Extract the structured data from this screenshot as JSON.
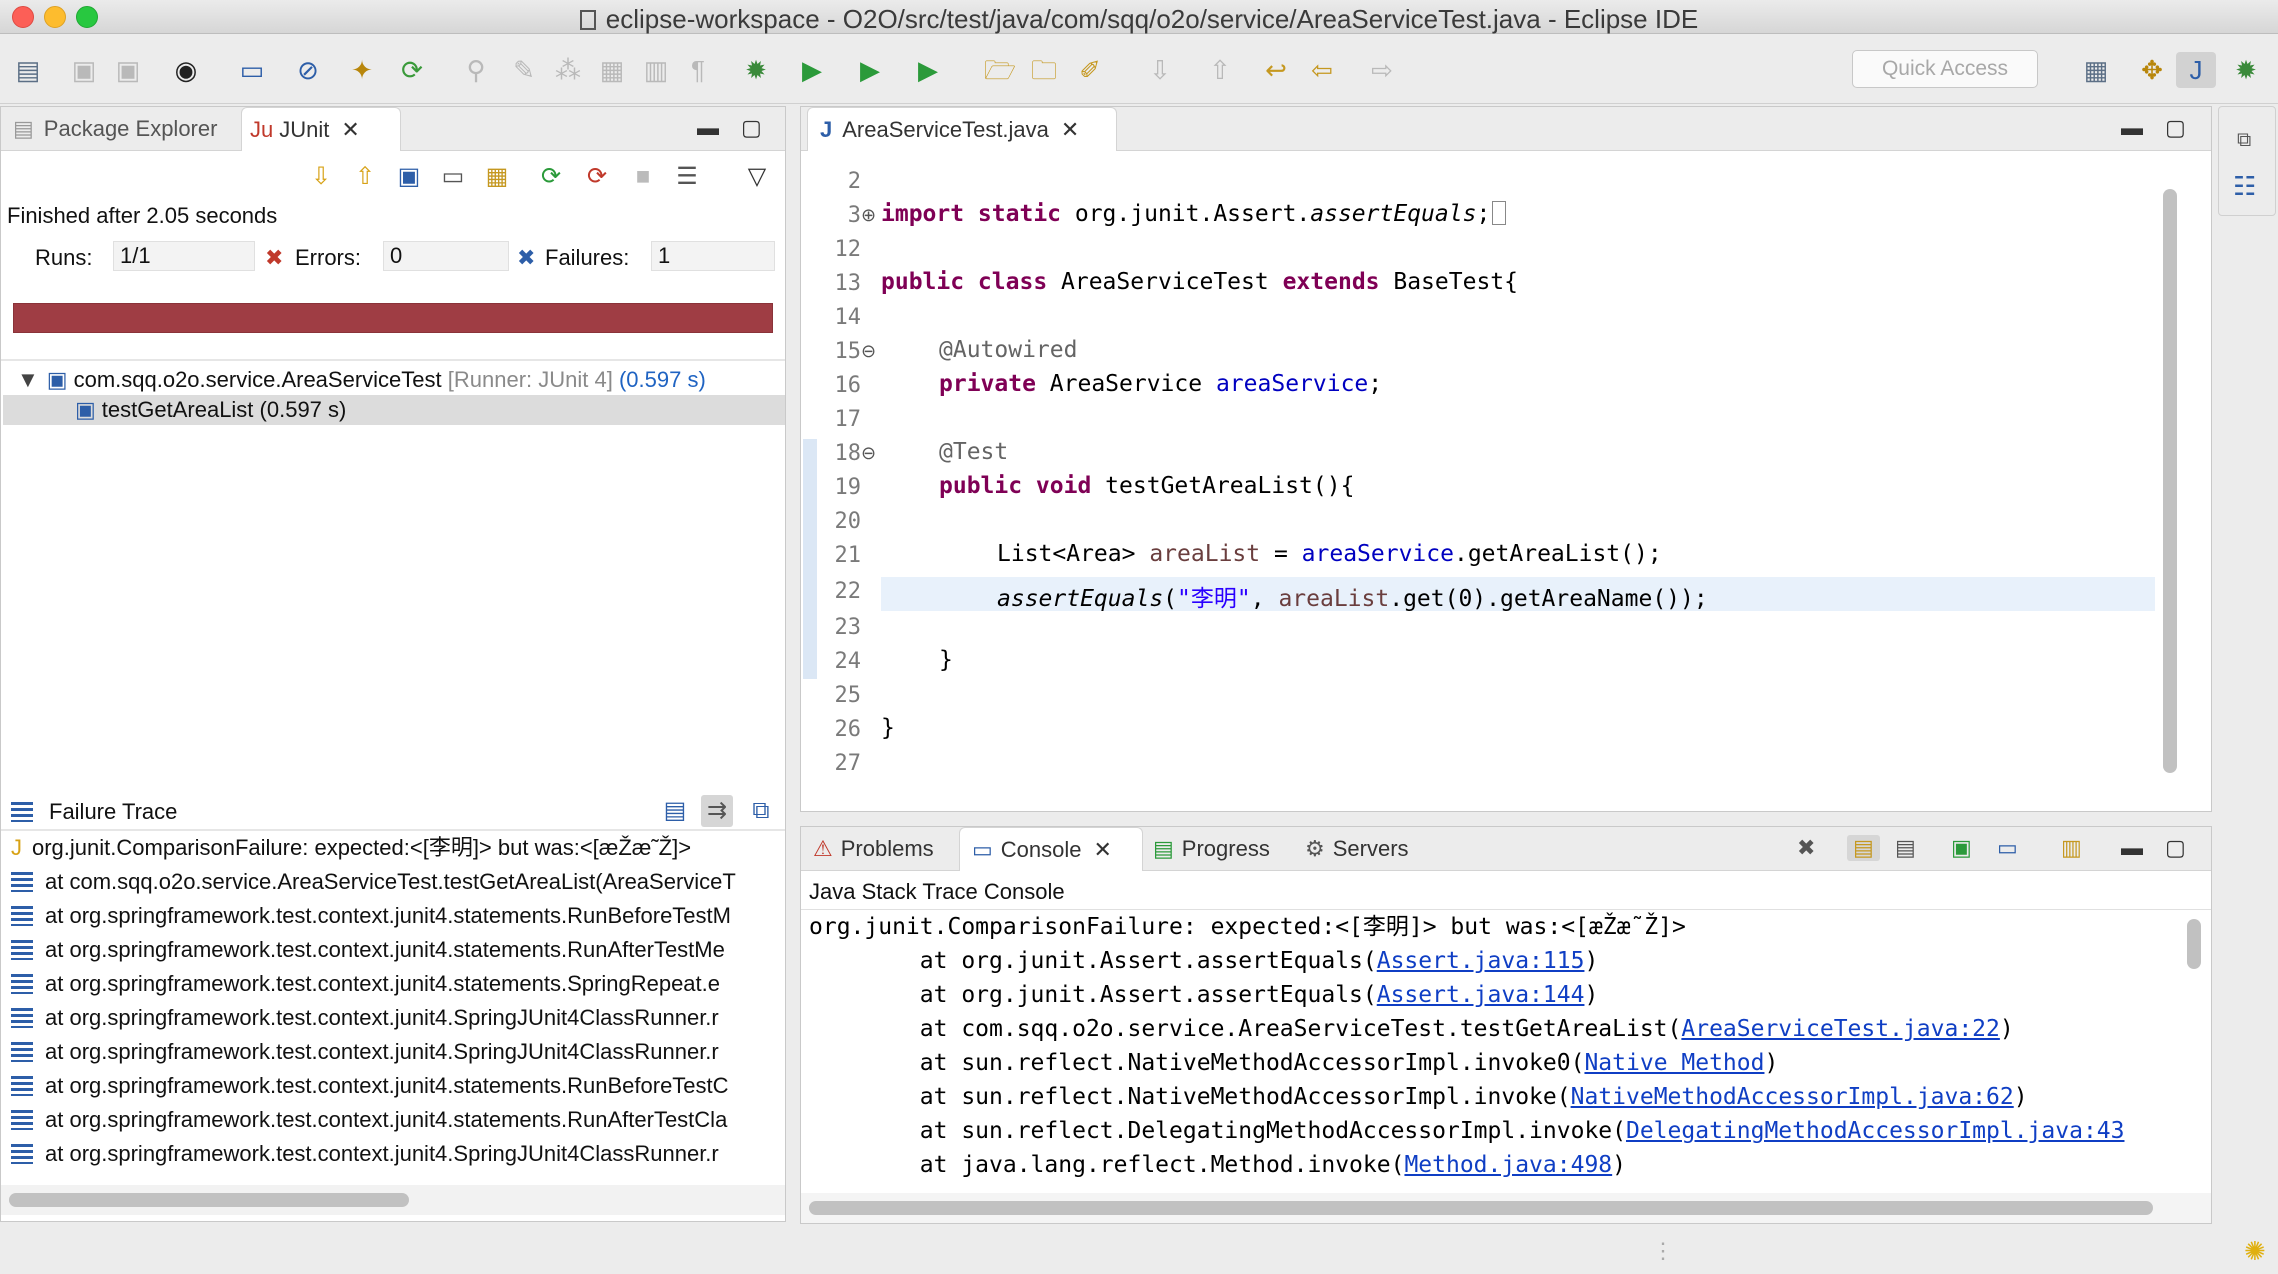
{
  "window": {
    "title": "eclipse-workspace - O2O/src/test/java/com/sqq/o2o/service/AreaServiceTest.java - Eclipse IDE"
  },
  "toolbar": {
    "quick_access_placeholder": "Quick Access"
  },
  "left_panel": {
    "tabs": [
      {
        "label": "Package Explorer",
        "active": false
      },
      {
        "label": "JUnit",
        "active": true
      }
    ],
    "status": "Finished after 2.05 seconds",
    "runs_label": "Runs:",
    "runs_value": "1/1",
    "errors_label": "Errors:",
    "errors_value": "0",
    "failures_label": "Failures:",
    "failures_value": "1",
    "progress_color": "#9f3d44",
    "tree": {
      "suite_name": "com.sqq.o2o.service.AreaServiceTest",
      "suite_runner": "[Runner: JUnit 4]",
      "suite_time": "(0.597 s)",
      "test_label": "testGetAreaList (0.597 s)"
    },
    "failure_trace_title": "Failure Trace",
    "failure_trace": [
      "org.junit.ComparisonFailure: expected:<[李明]> but was:<[æŽæ˜Ž]>",
      "at com.sqq.o2o.service.AreaServiceTest.testGetAreaList(AreaServiceT",
      "at org.springframework.test.context.junit4.statements.RunBeforeTestM",
      "at org.springframework.test.context.junit4.statements.RunAfterTestMe",
      "at org.springframework.test.context.junit4.statements.SpringRepeat.e",
      "at org.springframework.test.context.junit4.SpringJUnit4ClassRunner.r",
      "at org.springframework.test.context.junit4.SpringJUnit4ClassRunner.r",
      "at org.springframework.test.context.junit4.statements.RunBeforeTestC",
      "at org.springframework.test.context.junit4.statements.RunAfterTestCla",
      "at org.springframework.test.context.junit4.SpringJUnit4ClassRunner.r"
    ]
  },
  "editor": {
    "tab_label": "AreaServiceTest.java",
    "line_numbers": [
      "2",
      "3",
      "12",
      "13",
      "14",
      "15",
      "16",
      "17",
      "18",
      "19",
      "20",
      "21",
      "22",
      "23",
      "24",
      "25",
      "26",
      "27"
    ],
    "code": {
      "l3_import": "import static",
      "l3_rest": " org.junit.Assert.",
      "l3_method": "assertEquals",
      "l3_semi": ";",
      "l13_kw": "public class",
      "l13_name": " AreaServiceTest ",
      "l13_extends": "extends",
      "l13_rest": " BaseTest{",
      "l15_ann": "@Autowired",
      "l16_kw": "private",
      "l16_type": " AreaService ",
      "l16_field": "areaService",
      "l16_semi": ";",
      "l18_ann": "@Test",
      "l19_kw": "public void",
      "l19_rest": " testGetAreaList(){",
      "l21_type": "List<Area> ",
      "l21_var": "areaList",
      "l21_eq": " = ",
      "l21_field": "areaService",
      "l21_rest": ".getAreaList();",
      "l22_method": "assertEquals",
      "l22_open": "(",
      "l22_str": "\"李明\"",
      "l22_comma": ", ",
      "l22_var": "areaList",
      "l22_rest": ".get(0).getAreaName());",
      "l24_brace": "}",
      "l26_brace": "}"
    }
  },
  "bottom_panel": {
    "tabs": [
      {
        "label": "Problems",
        "active": false
      },
      {
        "label": "Console",
        "active": true
      },
      {
        "label": "Progress",
        "active": false
      },
      {
        "label": "Servers",
        "active": false
      }
    ],
    "console_title": "Java Stack Trace Console",
    "console_lines": [
      {
        "text": "org.junit.ComparisonFailure: expected:<[李明]> but was:<[æŽæ˜Ž]>",
        "link": "",
        "suffix": ""
      },
      {
        "text": "        at org.junit.Assert.assertEquals(",
        "link": "Assert.java:115",
        "suffix": ")"
      },
      {
        "text": "        at org.junit.Assert.assertEquals(",
        "link": "Assert.java:144",
        "suffix": ")"
      },
      {
        "text": "        at com.sqq.o2o.service.AreaServiceTest.testGetAreaList(",
        "link": "AreaServiceTest.java:22",
        "suffix": ")"
      },
      {
        "text": "        at sun.reflect.NativeMethodAccessorImpl.invoke0(",
        "link": "Native Method",
        "suffix": ")"
      },
      {
        "text": "        at sun.reflect.NativeMethodAccessorImpl.invoke(",
        "link": "NativeMethodAccessorImpl.java:62",
        "suffix": ")"
      },
      {
        "text": "        at sun.reflect.DelegatingMethodAccessorImpl.invoke(",
        "link": "DelegatingMethodAccessorImpl.java:43",
        "suffix": ""
      },
      {
        "text": "        at java.lang.reflect.Method.invoke(",
        "link": "Method.java:498",
        "suffix": ")"
      }
    ]
  }
}
